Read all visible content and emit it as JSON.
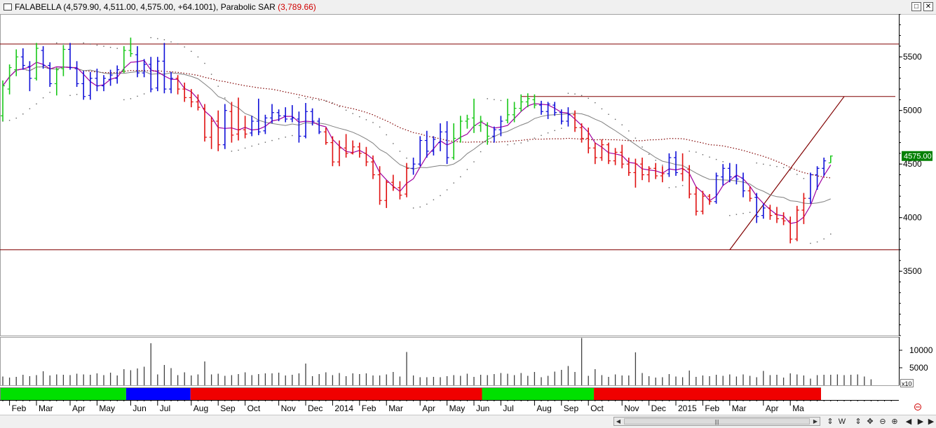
{
  "window": {
    "symbol": "FALABELLA",
    "quote": "(4,579.90, 4,511.00, 4,575.00, +64.1001),",
    "indicator_label": "Parabolic SAR",
    "indicator_value": "(3,789.66)",
    "btn_restore": "□",
    "btn_close": "✕"
  },
  "status_bar": {
    "scroll_left": "◀",
    "scroll_right": "▶",
    "scroll_grip": "|||",
    "tools": [
      "⇕",
      "W",
      "⇕",
      "✥",
      "⊖",
      "⊕",
      "◀",
      "▶",
      "▶"
    ]
  },
  "chart_data": {
    "type": "bar",
    "series_type": "ohlc weekly bars",
    "y_axis": {
      "ticks": [
        3500,
        4000,
        4500,
        5000,
        5500
      ],
      "range": [
        2900,
        5900
      ]
    },
    "last_price_label": "4575.00",
    "x_axis": {
      "labels": [
        "Feb",
        "Mar",
        "Apr",
        "May",
        "Jun",
        "Jul",
        "Aug",
        "Sep",
        "Oct",
        "Nov",
        "Dec",
        "2014",
        "Feb",
        "Mar",
        "Apr",
        "May",
        "Jun",
        "Jul",
        "Aug",
        "Sep",
        "Oct",
        "Nov",
        "Dec",
        "2015",
        "Feb",
        "Mar",
        "Apr",
        "Ma"
      ],
      "label_week_index": [
        1,
        5,
        10,
        14,
        19,
        23,
        28,
        32,
        36,
        41,
        45,
        49,
        53,
        57,
        62,
        66,
        70,
        74,
        79,
        83,
        87,
        92,
        96,
        100,
        104,
        108,
        113,
        117
      ]
    },
    "bars": [
      {
        "o": 4950,
        "h": 5280,
        "l": 4900,
        "c": 5230,
        "col": "green"
      },
      {
        "o": 5200,
        "h": 5430,
        "l": 5150,
        "c": 5400,
        "col": "green"
      },
      {
        "o": 5380,
        "h": 5570,
        "l": 5320,
        "c": 5500,
        "col": "green"
      },
      {
        "o": 5500,
        "h": 5580,
        "l": 5380,
        "c": 5420,
        "col": "blue"
      },
      {
        "o": 5410,
        "h": 5460,
        "l": 5180,
        "c": 5300,
        "col": "blue"
      },
      {
        "o": 5300,
        "h": 5630,
        "l": 5280,
        "c": 5580,
        "col": "green"
      },
      {
        "o": 5560,
        "h": 5600,
        "l": 5390,
        "c": 5420,
        "col": "blue"
      },
      {
        "o": 5420,
        "h": 5450,
        "l": 5220,
        "c": 5250,
        "col": "blue"
      },
      {
        "o": 5250,
        "h": 5400,
        "l": 5140,
        "c": 5380,
        "col": "green"
      },
      {
        "o": 5390,
        "h": 5610,
        "l": 5320,
        "c": 5570,
        "col": "green"
      },
      {
        "o": 5570,
        "h": 5630,
        "l": 5380,
        "c": 5400,
        "col": "blue"
      },
      {
        "o": 5390,
        "h": 5460,
        "l": 5220,
        "c": 5250,
        "col": "blue"
      },
      {
        "o": 5250,
        "h": 5370,
        "l": 5100,
        "c": 5130,
        "col": "blue"
      },
      {
        "o": 5140,
        "h": 5360,
        "l": 5100,
        "c": 5300,
        "col": "blue"
      },
      {
        "o": 5300,
        "h": 5390,
        "l": 5180,
        "c": 5230,
        "col": "blue"
      },
      {
        "o": 5230,
        "h": 5330,
        "l": 5180,
        "c": 5300,
        "col": "blue"
      },
      {
        "o": 5290,
        "h": 5380,
        "l": 5230,
        "c": 5330,
        "col": "blue"
      },
      {
        "o": 5300,
        "h": 5420,
        "l": 5250,
        "c": 5380,
        "col": "blue"
      },
      {
        "o": 5370,
        "h": 5600,
        "l": 5350,
        "c": 5560,
        "col": "green"
      },
      {
        "o": 5560,
        "h": 5680,
        "l": 5500,
        "c": 5530,
        "col": "green"
      },
      {
        "o": 5520,
        "h": 5600,
        "l": 5310,
        "c": 5350,
        "col": "blue"
      },
      {
        "o": 5350,
        "h": 5480,
        "l": 5310,
        "c": 5430,
        "col": "blue"
      },
      {
        "o": 5430,
        "h": 5500,
        "l": 5170,
        "c": 5200,
        "col": "blue"
      },
      {
        "o": 5210,
        "h": 5500,
        "l": 5180,
        "c": 5460,
        "col": "blue"
      },
      {
        "o": 5460,
        "h": 5630,
        "l": 5160,
        "c": 5200,
        "col": "blue"
      },
      {
        "o": 5200,
        "h": 5360,
        "l": 5160,
        "c": 5300,
        "col": "blue"
      },
      {
        "o": 5300,
        "h": 5330,
        "l": 5150,
        "c": 5200,
        "col": "red"
      },
      {
        "o": 5200,
        "h": 5260,
        "l": 5080,
        "c": 5120,
        "col": "red"
      },
      {
        "o": 5120,
        "h": 5200,
        "l": 5030,
        "c": 5080,
        "col": "red"
      },
      {
        "o": 5080,
        "h": 5150,
        "l": 5000,
        "c": 5030,
        "col": "red"
      },
      {
        "o": 5020,
        "h": 5060,
        "l": 4710,
        "c": 4750,
        "col": "red"
      },
      {
        "o": 4750,
        "h": 4940,
        "l": 4640,
        "c": 4900,
        "col": "red"
      },
      {
        "o": 4900,
        "h": 5000,
        "l": 4620,
        "c": 4680,
        "col": "red"
      },
      {
        "o": 4680,
        "h": 5060,
        "l": 4640,
        "c": 5000,
        "col": "blue"
      },
      {
        "o": 4990,
        "h": 5080,
        "l": 4700,
        "c": 4770,
        "col": "red"
      },
      {
        "o": 4780,
        "h": 5120,
        "l": 4720,
        "c": 4820,
        "col": "red"
      },
      {
        "o": 4820,
        "h": 4950,
        "l": 4740,
        "c": 4780,
        "col": "red"
      },
      {
        "o": 4790,
        "h": 4950,
        "l": 4760,
        "c": 4900,
        "col": "blue"
      },
      {
        "o": 4900,
        "h": 5110,
        "l": 4770,
        "c": 4800,
        "col": "blue"
      },
      {
        "o": 4810,
        "h": 4960,
        "l": 4780,
        "c": 4930,
        "col": "blue"
      },
      {
        "o": 4930,
        "h": 5060,
        "l": 4880,
        "c": 4980,
        "col": "blue"
      },
      {
        "o": 4980,
        "h": 5010,
        "l": 4900,
        "c": 4950,
        "col": "blue"
      },
      {
        "o": 4950,
        "h": 5030,
        "l": 4890,
        "c": 4920,
        "col": "blue"
      },
      {
        "o": 4920,
        "h": 5050,
        "l": 4890,
        "c": 4930,
        "col": "blue"
      },
      {
        "o": 4920,
        "h": 4990,
        "l": 4700,
        "c": 4760,
        "col": "blue"
      },
      {
        "o": 4760,
        "h": 5070,
        "l": 4740,
        "c": 4990,
        "col": "blue"
      },
      {
        "o": 4990,
        "h": 5020,
        "l": 4860,
        "c": 4900,
        "col": "blue"
      },
      {
        "o": 4900,
        "h": 4930,
        "l": 4780,
        "c": 4800,
        "col": "blue"
      },
      {
        "o": 4800,
        "h": 4840,
        "l": 4680,
        "c": 4700,
        "col": "red"
      },
      {
        "o": 4700,
        "h": 4760,
        "l": 4480,
        "c": 4520,
        "col": "red"
      },
      {
        "o": 4520,
        "h": 4720,
        "l": 4480,
        "c": 4650,
        "col": "red"
      },
      {
        "o": 4650,
        "h": 4780,
        "l": 4560,
        "c": 4600,
        "col": "red"
      },
      {
        "o": 4600,
        "h": 4720,
        "l": 4590,
        "c": 4660,
        "col": "red"
      },
      {
        "o": 4660,
        "h": 4700,
        "l": 4560,
        "c": 4600,
        "col": "red"
      },
      {
        "o": 4600,
        "h": 4660,
        "l": 4480,
        "c": 4520,
        "col": "red"
      },
      {
        "o": 4520,
        "h": 4580,
        "l": 4360,
        "c": 4400,
        "col": "red"
      },
      {
        "o": 4400,
        "h": 4480,
        "l": 4120,
        "c": 4160,
        "col": "red"
      },
      {
        "o": 4160,
        "h": 4350,
        "l": 4090,
        "c": 4330,
        "col": "red"
      },
      {
        "o": 4330,
        "h": 4400,
        "l": 4250,
        "c": 4280,
        "col": "red"
      },
      {
        "o": 4280,
        "h": 4340,
        "l": 4170,
        "c": 4210,
        "col": "red"
      },
      {
        "o": 4220,
        "h": 4510,
        "l": 4190,
        "c": 4460,
        "col": "red"
      },
      {
        "o": 4460,
        "h": 4560,
        "l": 4400,
        "c": 4500,
        "col": "blue"
      },
      {
        "o": 4500,
        "h": 4760,
        "l": 4480,
        "c": 4720,
        "col": "blue"
      },
      {
        "o": 4720,
        "h": 4810,
        "l": 4560,
        "c": 4620,
        "col": "blue"
      },
      {
        "o": 4620,
        "h": 4760,
        "l": 4580,
        "c": 4730,
        "col": "blue"
      },
      {
        "o": 4700,
        "h": 4880,
        "l": 4620,
        "c": 4800,
        "col": "blue"
      },
      {
        "o": 4800,
        "h": 4900,
        "l": 4500,
        "c": 4560,
        "col": "blue"
      },
      {
        "o": 4560,
        "h": 4880,
        "l": 4540,
        "c": 4740,
        "col": "green"
      },
      {
        "o": 4740,
        "h": 4950,
        "l": 4700,
        "c": 4900,
        "col": "green"
      },
      {
        "o": 4900,
        "h": 4960,
        "l": 4830,
        "c": 4920,
        "col": "green"
      },
      {
        "o": 4930,
        "h": 5110,
        "l": 4790,
        "c": 4860,
        "col": "green"
      },
      {
        "o": 4860,
        "h": 4950,
        "l": 4800,
        "c": 4900,
        "col": "green"
      },
      {
        "o": 4860,
        "h": 4890,
        "l": 4680,
        "c": 4760,
        "col": "green"
      },
      {
        "o": 4760,
        "h": 4850,
        "l": 4700,
        "c": 4820,
        "col": "blue"
      },
      {
        "o": 4820,
        "h": 4950,
        "l": 4760,
        "c": 4900,
        "col": "blue"
      },
      {
        "o": 4910,
        "h": 5110,
        "l": 4880,
        "c": 4960,
        "col": "green"
      },
      {
        "o": 4960,
        "h": 5080,
        "l": 4890,
        "c": 5020,
        "col": "green"
      },
      {
        "o": 5020,
        "h": 5150,
        "l": 4990,
        "c": 5080,
        "col": "green"
      },
      {
        "o": 5080,
        "h": 5160,
        "l": 5030,
        "c": 5110,
        "col": "green"
      },
      {
        "o": 5100,
        "h": 5150,
        "l": 5020,
        "c": 5050,
        "col": "green"
      },
      {
        "o": 5050,
        "h": 5090,
        "l": 4960,
        "c": 4990,
        "col": "blue"
      },
      {
        "o": 4990,
        "h": 5080,
        "l": 4920,
        "c": 5060,
        "col": "blue"
      },
      {
        "o": 5050,
        "h": 5080,
        "l": 4950,
        "c": 4980,
        "col": "blue"
      },
      {
        "o": 4980,
        "h": 5010,
        "l": 4870,
        "c": 4900,
        "col": "blue"
      },
      {
        "o": 4900,
        "h": 5030,
        "l": 4850,
        "c": 4960,
        "col": "blue"
      },
      {
        "o": 4960,
        "h": 5000,
        "l": 4800,
        "c": 4840,
        "col": "red"
      },
      {
        "o": 4840,
        "h": 4880,
        "l": 4700,
        "c": 4740,
        "col": "red"
      },
      {
        "o": 4740,
        "h": 4840,
        "l": 4600,
        "c": 4650,
        "col": "red"
      },
      {
        "o": 4650,
        "h": 4700,
        "l": 4500,
        "c": 4560,
        "col": "red"
      },
      {
        "o": 4560,
        "h": 4730,
        "l": 4530,
        "c": 4680,
        "col": "red"
      },
      {
        "o": 4680,
        "h": 4700,
        "l": 4500,
        "c": 4530,
        "col": "red"
      },
      {
        "o": 4530,
        "h": 4650,
        "l": 4490,
        "c": 4610,
        "col": "red"
      },
      {
        "o": 4610,
        "h": 4680,
        "l": 4460,
        "c": 4500,
        "col": "red"
      },
      {
        "o": 4500,
        "h": 4560,
        "l": 4390,
        "c": 4420,
        "col": "red"
      },
      {
        "o": 4420,
        "h": 4550,
        "l": 4280,
        "c": 4500,
        "col": "red"
      },
      {
        "o": 4500,
        "h": 4560,
        "l": 4350,
        "c": 4400,
        "col": "red"
      },
      {
        "o": 4400,
        "h": 4480,
        "l": 4330,
        "c": 4460,
        "col": "red"
      },
      {
        "o": 4460,
        "h": 4510,
        "l": 4360,
        "c": 4390,
        "col": "red"
      },
      {
        "o": 4390,
        "h": 4480,
        "l": 4330,
        "c": 4410,
        "col": "red"
      },
      {
        "o": 4410,
        "h": 4600,
        "l": 4380,
        "c": 4560,
        "col": "blue"
      },
      {
        "o": 4560,
        "h": 4620,
        "l": 4390,
        "c": 4420,
        "col": "blue"
      },
      {
        "o": 4410,
        "h": 4600,
        "l": 4340,
        "c": 4450,
        "col": "red"
      },
      {
        "o": 4450,
        "h": 4490,
        "l": 4180,
        "c": 4220,
        "col": "red"
      },
      {
        "o": 4220,
        "h": 4290,
        "l": 4020,
        "c": 4060,
        "col": "red"
      },
      {
        "o": 4060,
        "h": 4250,
        "l": 4030,
        "c": 4200,
        "col": "red"
      },
      {
        "o": 4200,
        "h": 4220,
        "l": 4120,
        "c": 4150,
        "col": "red"
      },
      {
        "o": 4150,
        "h": 4420,
        "l": 4130,
        "c": 4390,
        "col": "blue"
      },
      {
        "o": 4380,
        "h": 4500,
        "l": 4300,
        "c": 4460,
        "col": "blue"
      },
      {
        "o": 4460,
        "h": 4510,
        "l": 4330,
        "c": 4380,
        "col": "blue"
      },
      {
        "o": 4380,
        "h": 4500,
        "l": 4310,
        "c": 4360,
        "col": "blue"
      },
      {
        "o": 4370,
        "h": 4420,
        "l": 4190,
        "c": 4250,
        "col": "blue"
      },
      {
        "o": 4250,
        "h": 4290,
        "l": 4150,
        "c": 4180,
        "col": "red"
      },
      {
        "o": 4190,
        "h": 4230,
        "l": 3950,
        "c": 4010,
        "col": "blue"
      },
      {
        "o": 4020,
        "h": 4130,
        "l": 3990,
        "c": 4090,
        "col": "blue"
      },
      {
        "o": 4090,
        "h": 4120,
        "l": 3980,
        "c": 4020,
        "col": "red"
      },
      {
        "o": 4030,
        "h": 4100,
        "l": 3950,
        "c": 3990,
        "col": "red"
      },
      {
        "o": 3990,
        "h": 4050,
        "l": 3930,
        "c": 3970,
        "col": "red"
      },
      {
        "o": 3970,
        "h": 4010,
        "l": 3760,
        "c": 3800,
        "col": "red"
      },
      {
        "o": 3800,
        "h": 4110,
        "l": 3780,
        "c": 4070,
        "col": "red"
      },
      {
        "o": 4070,
        "h": 4230,
        "l": 3940,
        "c": 4180,
        "col": "red"
      },
      {
        "o": 4180,
        "h": 4420,
        "l": 4130,
        "c": 4400,
        "col": "blue"
      },
      {
        "o": 4400,
        "h": 4480,
        "l": 4260,
        "c": 4460,
        "col": "blue"
      },
      {
        "o": 4460,
        "h": 4560,
        "l": 4390,
        "c": 4530,
        "col": "blue"
      },
      {
        "o": 4511,
        "h": 4579.9,
        "l": 4511,
        "c": 4575,
        "col": "green"
      }
    ],
    "volume": {
      "y_axis": {
        "ticks": [
          5000,
          10000
        ],
        "range": [
          0,
          13000
        ],
        "scale_label": "x10"
      },
      "values": [
        2500,
        2200,
        2400,
        3000,
        2600,
        2900,
        4000,
        2800,
        3100,
        3000,
        2900,
        3300,
        3100,
        3000,
        3400,
        2900,
        3600,
        2800,
        4600,
        4300,
        4800,
        5300,
        12000,
        3100,
        5800,
        4900,
        2900,
        3700,
        2800,
        3100,
        6800,
        3100,
        3300,
        2700,
        2900,
        3200,
        3700,
        2900,
        3200,
        3400,
        3400,
        3600,
        2800,
        3000,
        3400,
        6200,
        2600,
        3200,
        3700,
        2900,
        3500,
        2600,
        3400,
        3200,
        3400,
        2800,
        2800,
        3100,
        3800,
        2500,
        9500,
        2800,
        2300,
        2300,
        2400,
        2300,
        2600,
        2900,
        2700,
        3300,
        2400,
        3000,
        2900,
        3200,
        3500,
        3300,
        2900,
        3500,
        2700,
        3800,
        2300,
        2700,
        3900,
        4400,
        5500,
        3800,
        13500,
        2700,
        4600,
        2900,
        2400,
        3100,
        2800,
        2800,
        9400,
        3500,
        2600,
        2200,
        2300,
        3200,
        2500,
        2300,
        4200,
        2400,
        2800,
        2600,
        3000,
        2700,
        3100,
        2500,
        3100,
        2700,
        2300,
        4100,
        2900,
        3000,
        2200,
        3400,
        3100,
        2800,
        1900,
        2900,
        3000,
        3000,
        3100,
        2900,
        3000,
        3100,
        2500,
        1700
      ]
    },
    "trend_bands": [
      {
        "from": 0,
        "to": 37,
        "color": "green"
      },
      {
        "from": 37,
        "to": 56,
        "color": "blue"
      },
      {
        "from": 56,
        "to": 142,
        "color": "red"
      },
      {
        "from": 142,
        "to": 175,
        "color": "green"
      },
      {
        "from": 175,
        "to": 242,
        "color": "red"
      }
    ],
    "annotations": {
      "resistance_high": 5620,
      "support_low": 3700,
      "resistance_mid": 5130,
      "trend_line": [
        [
          108,
          3700
        ],
        [
          125,
          5130
        ]
      ],
      "colors": {
        "hline": "#800000",
        "up": "#19c819",
        "down": "#e01010",
        "neutral": "#1010d8",
        "ma_fast": "#a000a0",
        "ma_slow": "#808080",
        "ma_long": "#800000",
        "sar": "#606060",
        "price_tag": "#008000"
      }
    }
  }
}
